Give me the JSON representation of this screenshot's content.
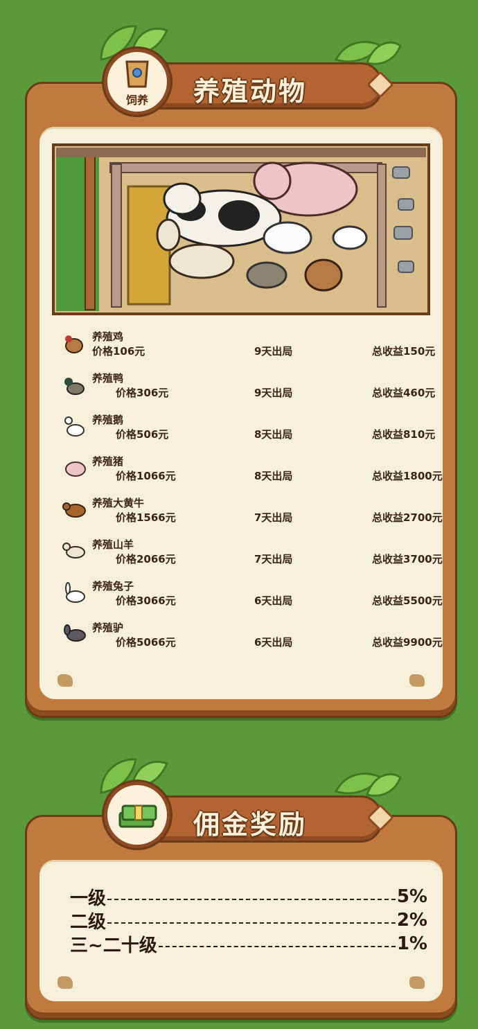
{
  "section1": {
    "title": "养殖动物",
    "badge_label": "饲养",
    "animals": [
      {
        "icon": "rooster-icon",
        "name": "养殖鸡",
        "price": "价格106元",
        "days": "9天出局",
        "total": "总收益150元"
      },
      {
        "icon": "duck-icon",
        "name": "养殖鸭",
        "price": "价格306元",
        "days": "9天出局",
        "total": "总收益460元"
      },
      {
        "icon": "goose-icon",
        "name": "养殖鹅",
        "price": "价格506元",
        "days": "8天出局",
        "total": "总收益810元"
      },
      {
        "icon": "pig-icon",
        "name": "养殖猪",
        "price": "价格1066元",
        "days": "8天出局",
        "total": "总收益1800元"
      },
      {
        "icon": "ox-icon",
        "name": "养殖大黄牛",
        "price": "价格1566元",
        "days": "7天出局",
        "total": "总收益2700元"
      },
      {
        "icon": "goat-icon",
        "name": "养殖山羊",
        "price": "价格2066元",
        "days": "7天出局",
        "total": "总收益3700元"
      },
      {
        "icon": "rabbit-icon",
        "name": "养殖兔子",
        "price": "价格3066元",
        "days": "6天出局",
        "total": "总收益5500元"
      },
      {
        "icon": "donkey-icon",
        "name": "养殖驴",
        "price": "价格5066元",
        "days": "6天出局",
        "total": "总收益9900元"
      }
    ]
  },
  "section2": {
    "title": "佣金奖励",
    "levels": [
      {
        "level": "一级",
        "percent": "5%"
      },
      {
        "level": "二级",
        "percent": "2%"
      },
      {
        "level": "三~二十级",
        "percent": "1%"
      }
    ]
  },
  "colors": {
    "background": "#5a9a3a",
    "card": "#c07a3e",
    "panel": "#f6efd9",
    "banner": "#b46431",
    "text": "#3b2412"
  }
}
